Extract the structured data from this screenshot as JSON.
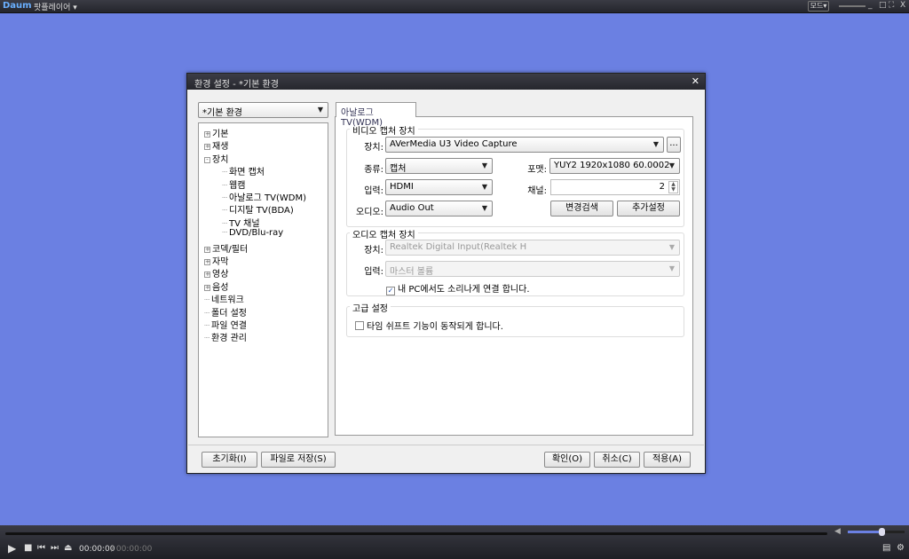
{
  "app": {
    "logo": "Daum",
    "title": "팟플레이어 ▾",
    "mode": "모드▾",
    "window_controls": [
      "_",
      "□",
      "⛶",
      "X"
    ]
  },
  "dialog": {
    "title": "환경 설정 - *기본 환경",
    "preset": "*기본 환경",
    "tree": [
      {
        "label": "기본",
        "level": 0,
        "expander": "+"
      },
      {
        "label": "재생",
        "level": 0,
        "expander": "+"
      },
      {
        "label": "장치",
        "level": 0,
        "expander": "-"
      },
      {
        "label": "화면 캡처",
        "level": 1
      },
      {
        "label": "웹캠",
        "level": 1
      },
      {
        "label": "아날로그 TV(WDM)",
        "level": 1
      },
      {
        "label": "디지탈 TV(BDA)",
        "level": 1
      },
      {
        "label": "TV 채널",
        "level": 1
      },
      {
        "label": "DVD/Blu-ray",
        "level": 1
      },
      {
        "label": "코덱/필터",
        "level": 0,
        "expander": "+"
      },
      {
        "label": "자막",
        "level": 0,
        "expander": "+"
      },
      {
        "label": "영상",
        "level": 0,
        "expander": "+"
      },
      {
        "label": "음성",
        "level": 0,
        "expander": "+"
      },
      {
        "label": "네트워크",
        "level": 0
      },
      {
        "label": "폴더 설정",
        "level": 0
      },
      {
        "label": "파일 연결",
        "level": 0
      },
      {
        "label": "환경 관리",
        "level": 0
      }
    ],
    "tab": "아날로그 TV(WDM)",
    "video": {
      "title": "비디오 캡처 장치",
      "device_label": "장치:",
      "device": "AVerMedia U3 Video Capture",
      "more": "...",
      "type_label": "종류:",
      "type": "캡처",
      "format_label": "포맷:",
      "format": "YUY2 1920x1080 60.0002",
      "input_label": "입력:",
      "input": "HDMI",
      "channel_label": "채널:",
      "channel": "2",
      "audio_label": "오디오:",
      "audio": "Audio Out",
      "scan_button": "변경검색",
      "extra_button": "추가설정"
    },
    "audio": {
      "title": "오디오 캡처 장치",
      "device_label": "장치:",
      "device": "Realtek Digital Input(Realtek H",
      "input_label": "입력:",
      "input": "마스터 볼륨",
      "monitor_label": "내 PC에서도 소리나게 연결 합니다.",
      "monitor_checked": true
    },
    "advanced": {
      "title": "고급 설정",
      "timeshift_label": "타임 쉬프트 기능이 동작되게 합니다.",
      "timeshift_checked": false
    },
    "buttons": {
      "reset": "초기화(I)",
      "save_file": "파일로 저장(S)",
      "ok": "확인(O)",
      "cancel": "취소(C)",
      "apply": "적용(A)"
    }
  },
  "player": {
    "time": "00:00:00",
    "duration": " / 00:00:00",
    "volume": 0.6
  }
}
